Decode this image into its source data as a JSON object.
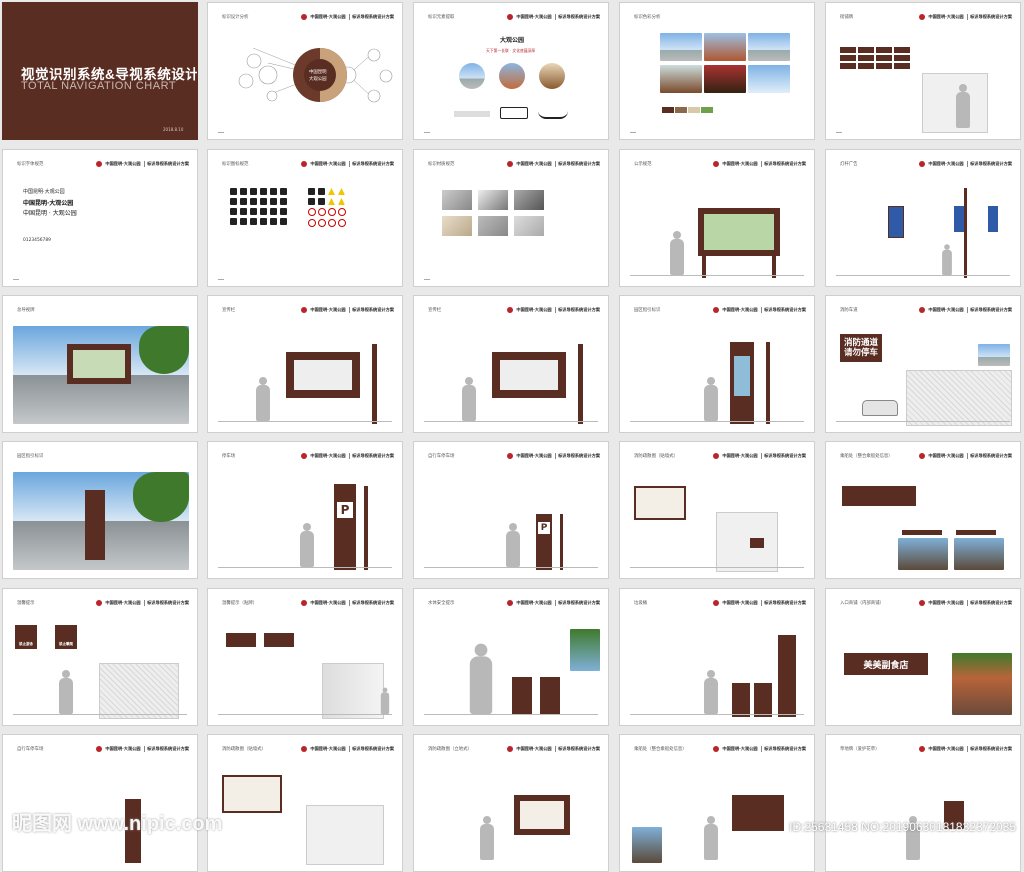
{
  "cover": {
    "title": "视觉识别系统&导视系统设计",
    "subtitle": "TOTAL NAVIGATION CHART",
    "date": "2018.8.10"
  },
  "header": {
    "project": "中国昆明·大观公园",
    "doc": "标识导视系统设计方案"
  },
  "pages": [
    {
      "title": "标识设计分析"
    },
    {
      "title": "标识元素提取"
    },
    {
      "title": "标识色彩分析"
    },
    {
      "title": "街铺牌"
    },
    {
      "title": "标识字体规范"
    },
    {
      "title": "标识图标规范"
    },
    {
      "title": "标识材质规范"
    },
    {
      "title": "公示规范"
    },
    {
      "title": "灯杆广告"
    },
    {
      "title": "总导视牌"
    },
    {
      "title": "宣传栏"
    },
    {
      "title": "宣传栏"
    },
    {
      "title": "园区指引标识"
    },
    {
      "title": "消防车道"
    },
    {
      "title": "园区指引标识"
    },
    {
      "title": "停车场"
    },
    {
      "title": "自行车停车场"
    },
    {
      "title": "消防疏散图（贴墙式）"
    },
    {
      "title": "乘船处（整合乘船处信息）"
    },
    {
      "title": "温馨提示"
    },
    {
      "title": "温馨提示（贴牌）"
    },
    {
      "title": "水体安全提示"
    },
    {
      "title": "垃圾桶"
    },
    {
      "title": "入口商铺（内部商铺）"
    },
    {
      "title": "自行车停车场"
    },
    {
      "title": "消防疏散图（贴墙式）"
    },
    {
      "title": "消防疏散图（立地式）"
    },
    {
      "title": "乘船处（整合乘船处信息）"
    },
    {
      "title": "草地牌（爱护花草）"
    }
  ],
  "analysis": {
    "center_lines": [
      "中国昆明",
      "大观公园"
    ],
    "park_name": "大观公园",
    "tagline": "天下第一长联 · 文化底蕴深厚"
  },
  "fonts": {
    "lines": [
      "中国昆明·大观公园",
      "中国昆明·大观公园",
      "中国昆明 · 大观公园"
    ],
    "digits": "0123456789"
  },
  "signs": {
    "fire_lane_1": "消防通道",
    "fire_lane_2": "请勿停车",
    "restaurant": "美美副食店",
    "parking": "P",
    "warning_1": "禁止游泳",
    "warning_2": "禁止攀爬"
  },
  "watermark": {
    "logo_text": "昵图网 www.nipic.com",
    "id_text": "ID:25631458 NO:20190630181832372035"
  },
  "colors": {
    "brand_brown": "#5a2d22",
    "accent_red": "#b8262c"
  }
}
